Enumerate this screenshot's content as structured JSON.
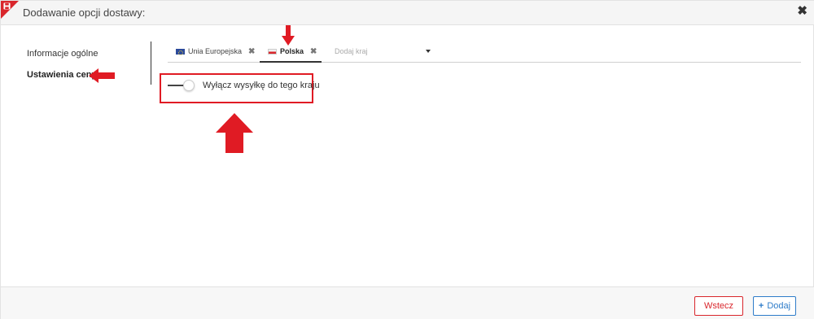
{
  "header": {
    "title": "Dodawanie opcji dostawy:",
    "close_label": "✖"
  },
  "sidebar": {
    "items": [
      {
        "label": "Informacje ogólne",
        "active": false
      },
      {
        "label": "Ustawienia ceny",
        "active": true
      }
    ]
  },
  "tabs": {
    "items": [
      {
        "label": "Unia Europejska",
        "flag": "eu-flag-icon",
        "active": false
      },
      {
        "label": "Polska",
        "flag": "poland-flag-icon",
        "active": true
      }
    ],
    "add_country_placeholder": "Dodaj kraj",
    "remove_label": "✖"
  },
  "settings": {
    "toggle_label": "Wyłącz wysyłkę do tego kraju",
    "toggle_on": false
  },
  "footer": {
    "back_label": "Wstecz",
    "add_label": "Dodaj"
  },
  "colors": {
    "accent_red": "#d9262c",
    "annotation_red": "#e01b24",
    "primary_blue": "#2e7cc9"
  }
}
